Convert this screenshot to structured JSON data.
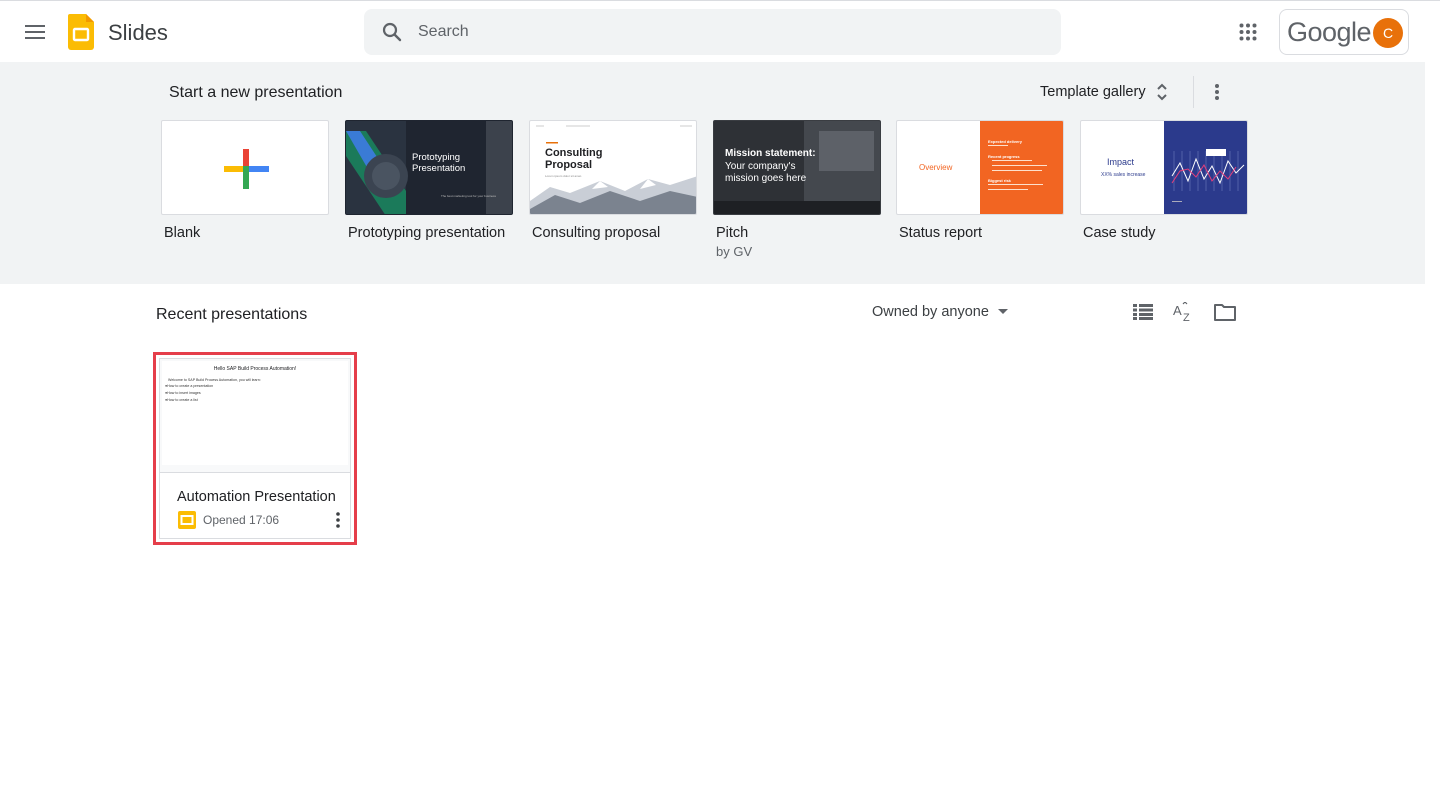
{
  "header": {
    "app_name": "Slides",
    "search_placeholder": "Search",
    "account_brand": "Google",
    "avatar_initial": "C",
    "icons": [
      "hamburger-menu-icon",
      "slides-logo-icon",
      "search-icon",
      "apps-grid-icon"
    ]
  },
  "templates": {
    "section_title": "Start a new presentation",
    "gallery_label": "Template gallery",
    "items": [
      {
        "name": "Blank",
        "sub": ""
      },
      {
        "name": "Prototyping presentation",
        "sub": "",
        "thumb_title": "Prototyping Presentation",
        "thumb_caption": "The best marketing tool for your business"
      },
      {
        "name": "Consulting proposal",
        "sub": "",
        "thumb_title": "Consulting Proposal",
        "thumb_caption": "Lorem ipsum dolor sit amet."
      },
      {
        "name": "Pitch",
        "sub": "by GV",
        "thumb_title": "Mission statement:",
        "thumb_body": "Your company's mission goes here"
      },
      {
        "name": "Status report",
        "sub": "",
        "thumb_title": "Overview",
        "thumb_side_title": "Expected delivery",
        "thumb_side_lines": [
          "Recent progress",
          "Biggest risk"
        ]
      },
      {
        "name": "Case study",
        "sub": "",
        "thumb_title": "Impact",
        "thumb_caption": "XX% sales increase"
      }
    ]
  },
  "recent": {
    "section_title": "Recent presentations",
    "owner_filter": "Owned by anyone",
    "docs": [
      {
        "name": "Automation Presentation",
        "opened": "Opened 17:06",
        "thumb_title": "Hello SAP Build Process Automation!",
        "thumb_intro": "Welcome to SAP Build Process Automation, you will learn:",
        "thumb_bullets": [
          "How to create a presentation",
          "How to insert images",
          "How to create a list"
        ]
      }
    ]
  },
  "colors": {
    "slides_yellow": "#fbbc04",
    "highlight_border": "#e53e4a",
    "avatar_bg": "#e8710a",
    "orange_template": "#f26522",
    "case_study_navy": "#2b3a8c"
  }
}
